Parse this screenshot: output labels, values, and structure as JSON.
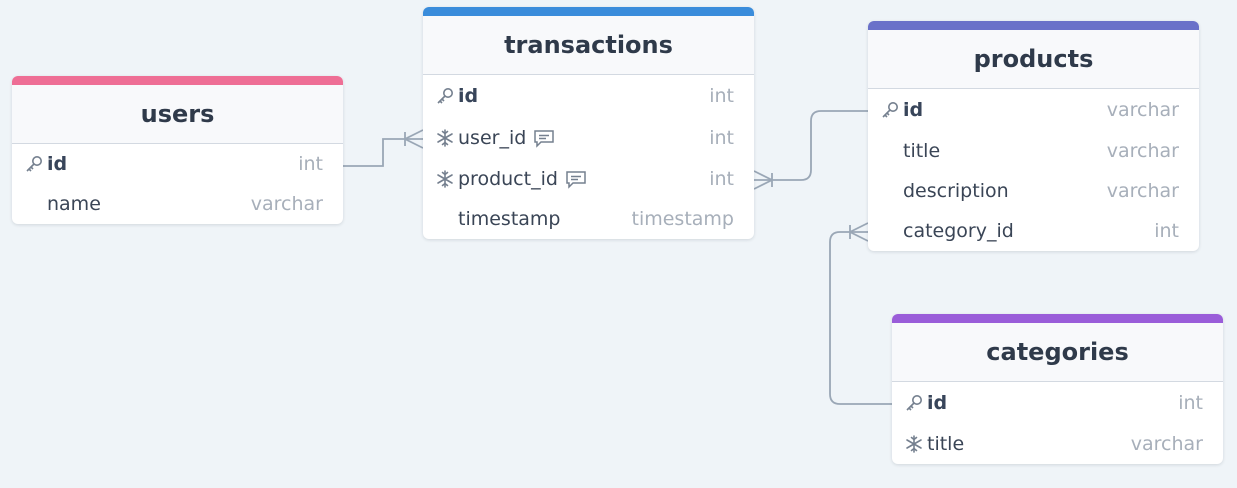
{
  "colors": {
    "users": "#ee6e95",
    "transactions": "#3a8cdb",
    "products": "#6a71c9",
    "categories": "#9a5dd9",
    "link": "#9aa7b6"
  },
  "tables": {
    "users": {
      "title": "users",
      "fields": [
        {
          "name": "id",
          "type": "int",
          "icon": "key-icon"
        },
        {
          "name": "name",
          "type": "varchar",
          "icon": ""
        }
      ]
    },
    "transactions": {
      "title": "transactions",
      "fields": [
        {
          "name": "id",
          "type": "int",
          "icon": "key-icon"
        },
        {
          "name": "user_id",
          "type": "int",
          "icon": "snowflake-icon",
          "note": true
        },
        {
          "name": "product_id",
          "type": "int",
          "icon": "snowflake-icon",
          "note": true
        },
        {
          "name": "timestamp",
          "type": "timestamp",
          "icon": ""
        }
      ]
    },
    "products": {
      "title": "products",
      "fields": [
        {
          "name": "id",
          "type": "varchar",
          "icon": "key-icon"
        },
        {
          "name": "title",
          "type": "varchar",
          "icon": ""
        },
        {
          "name": "description",
          "type": "varchar",
          "icon": ""
        },
        {
          "name": "category_id",
          "type": "int",
          "icon": ""
        }
      ]
    },
    "categories": {
      "title": "categories",
      "fields": [
        {
          "name": "id",
          "type": "int",
          "icon": "key-icon"
        },
        {
          "name": "title",
          "type": "varchar",
          "icon": "snowflake-icon"
        }
      ]
    }
  }
}
